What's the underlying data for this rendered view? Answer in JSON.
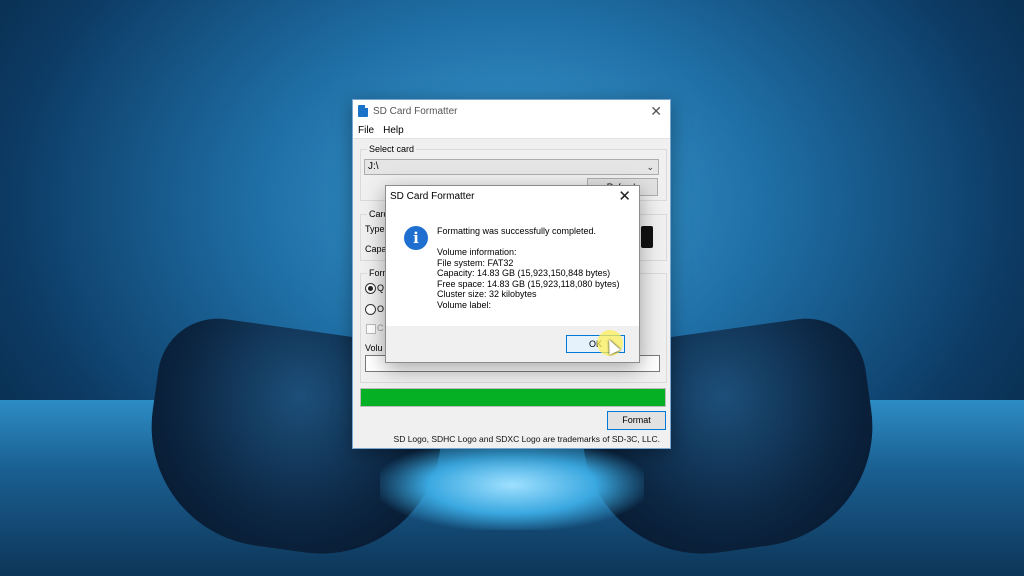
{
  "main_window": {
    "title": "SD Card Formatter",
    "menu": [
      "File",
      "Help"
    ],
    "select_card_label": "Select card",
    "selected_card": "J:\\",
    "refresh_label": "Refresh",
    "card_info_label": "Card",
    "type_label": "Type",
    "capacity_label": "Capa",
    "format_options_label": "Form",
    "quick_format_label": "Q",
    "overwrite_format_label": "O",
    "cluster_option_label": "C",
    "volume_label_label": "Volu",
    "progress_fraction": 1.0,
    "format_button": "Format",
    "trademark": "SD Logo, SDHC Logo and SDXC Logo are trademarks of SD-3C, LLC."
  },
  "dialog": {
    "title": "SD Card Formatter",
    "message": "Formatting was successfully completed.",
    "volume_info_heading": "Volume information:",
    "file_system": "File system: FAT32",
    "capacity": "Capacity: 14.83 GB (15,923,150,848 bytes)",
    "free_space": "Free space: 14.83 GB (15,923,118,080 bytes)",
    "cluster_size": "Cluster size: 32 kilobytes",
    "volume_label": "Volume label:",
    "ok_button": "OK",
    "icon": "info-icon"
  },
  "colors": {
    "progress": "#06b025",
    "accent": "#0078d7",
    "info_icon": "#1e6fcf"
  }
}
